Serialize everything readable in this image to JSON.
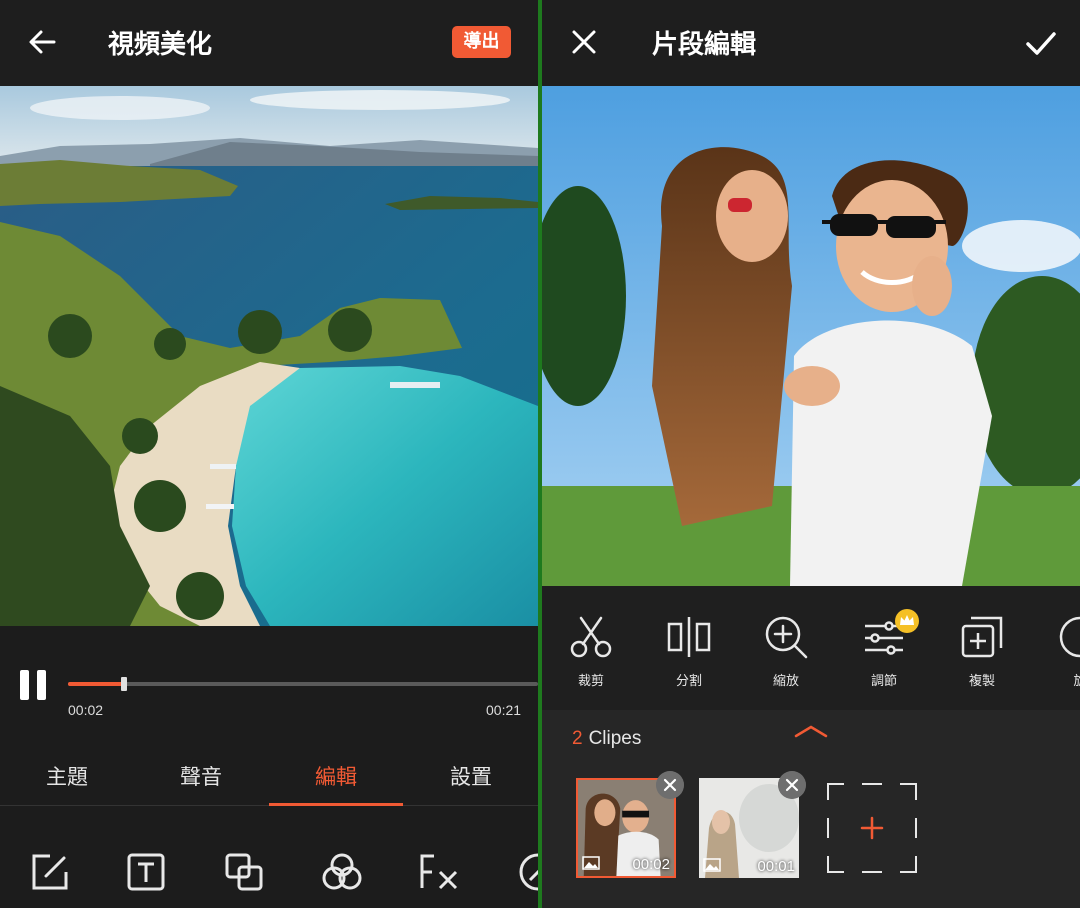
{
  "left": {
    "title": "視頻美化",
    "export_label": "導出",
    "player": {
      "current_time": "00:02",
      "total_time": "00:21",
      "progress": 0.12
    },
    "tabs": [
      {
        "label": "主題",
        "active": false
      },
      {
        "label": "聲音",
        "active": false
      },
      {
        "label": "編輯",
        "active": true
      },
      {
        "label": "設置",
        "active": false
      }
    ],
    "tools": [
      {
        "icon": "edit-square-icon"
      },
      {
        "icon": "text-icon"
      },
      {
        "icon": "overlap-squares-icon"
      },
      {
        "icon": "filter-circles-icon"
      },
      {
        "icon": "fx-icon"
      },
      {
        "icon": "speed-icon"
      }
    ]
  },
  "right": {
    "title": "片段編輯",
    "toolbar": [
      {
        "label": "裁剪",
        "icon": "scissors-icon"
      },
      {
        "label": "分割",
        "icon": "split-icon"
      },
      {
        "label": "縮放",
        "icon": "zoom-in-icon"
      },
      {
        "label": "調節",
        "icon": "adjust-sliders-icon"
      },
      {
        "label": "複製",
        "icon": "duplicate-icon"
      },
      {
        "label": "旋",
        "icon": "rotate-icon"
      }
    ],
    "clips": {
      "count": "2",
      "count_label": "Clipes",
      "items": [
        {
          "duration": "00:02",
          "selected": true
        },
        {
          "duration": "00:01",
          "selected": false
        }
      ]
    }
  },
  "colors": {
    "accent": "#f15a34",
    "background": "#1c1c1c",
    "divider": "#1e7a1e"
  }
}
